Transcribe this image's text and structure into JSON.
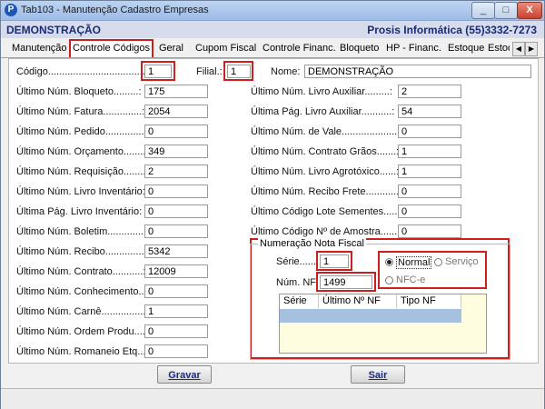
{
  "window": {
    "title": "Tab103 - Manutenção Cadastro Empresas",
    "app_icon": "P",
    "minimize_label": "_",
    "maximize_label": "□",
    "close_label": "X"
  },
  "header": {
    "company": "DEMONSTRAÇÃO",
    "vendor": "Prosis Informática (55)3332-7273"
  },
  "tabs": [
    "Manutenção",
    "Controle Códigos",
    "Geral",
    "Cupom Fiscal",
    "Controle Financ.",
    "Bloqueto",
    "HP - Financ.",
    "Estoque",
    "Estoq"
  ],
  "tab_scroll": {
    "left": "◀",
    "right": "▶"
  },
  "top_row": {
    "codigo_label": "Código.......................................:",
    "codigo_value": "1",
    "filial_label": "Filial.:",
    "filial_value": "1",
    "nome_label": "Nome:",
    "nome_value": "DEMONSTRAÇÃO"
  },
  "left_fields": [
    {
      "label": "Último Núm. Bloqueto.........:",
      "value": "175"
    },
    {
      "label": "Último Núm. Fatura..............:",
      "value": "2054"
    },
    {
      "label": "Último Núm. Pedido...............:",
      "value": "0"
    },
    {
      "label": "Último Núm. Orçamento.........:",
      "value": "349"
    },
    {
      "label": "Último Núm. Requisição........:",
      "value": "2"
    },
    {
      "label": "Último Núm. Livro Inventário:",
      "value": "0"
    },
    {
      "label": "Última  Pág. Livro  Inventário:",
      "value": "0"
    },
    {
      "label": "Último Núm. Boletim.............:",
      "value": "0"
    },
    {
      "label": "Último Núm. Recibo..............:",
      "value": "5342"
    },
    {
      "label": "Último Núm. Contrato...........:",
      "value": "12009"
    },
    {
      "label": "Último Núm. Conhecimento...:",
      "value": "0"
    },
    {
      "label": "Último Núm. Carnê................:",
      "value": "1"
    },
    {
      "label": "Último Núm. Ordem Produ.....:",
      "value": "0"
    },
    {
      "label": "Último Núm. Romaneio Etq...:",
      "value": "0"
    }
  ],
  "right_fields": [
    {
      "label": "Último Núm. Livro Auxiliar.........:",
      "value": "2"
    },
    {
      "label": "Última Pág. Livro Auxiliar...........:",
      "value": "54"
    },
    {
      "label": "Último Núm. de Vale....................:",
      "value": "0"
    },
    {
      "label": "Último Núm. Contrato Grãos.......:",
      "value": "1"
    },
    {
      "label": "Último Núm. Livro Agrotóxico......:",
      "value": "1"
    },
    {
      "label": "Último Núm. Recibo Frete............:",
      "value": "0"
    },
    {
      "label": "Último Código Lote Sementes......:",
      "value": "0"
    },
    {
      "label": "Último Código Nº de Amostra........:",
      "value": "0"
    }
  ],
  "nota_fiscal": {
    "title": "Numeração Nota Fiscal",
    "serie_label": "Série........:",
    "serie_value": "1",
    "num_nf_label": "Núm. NF:",
    "num_nf_value": "1499",
    "radio_normal": "Normal",
    "radio_servico": "Serviço",
    "radio_nfce": "NFC-e",
    "selected": "Normal",
    "grid_columns": [
      "Série",
      "Último Nº NF",
      "Tipo NF"
    ]
  },
  "buttons": {
    "gravar": "Gravar",
    "sair": "Sair"
  }
}
